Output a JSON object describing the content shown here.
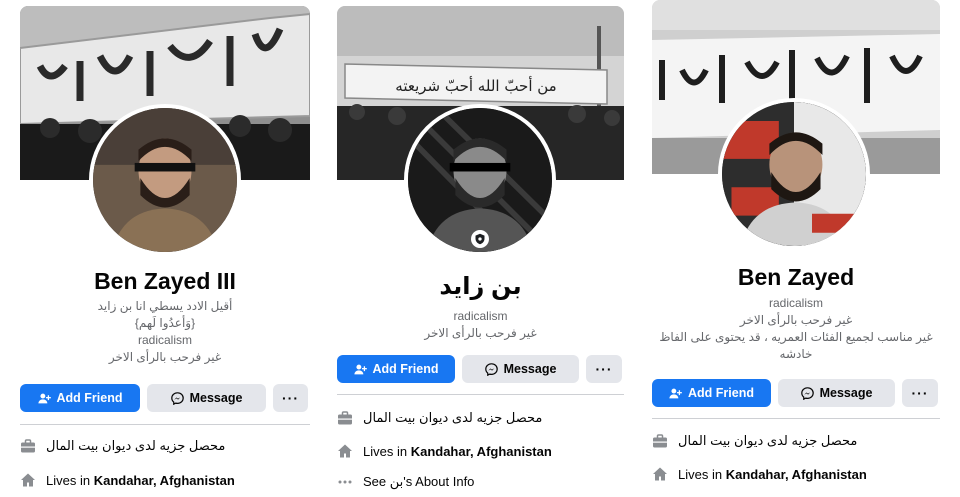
{
  "profiles": [
    {
      "name": "Ben Zayed III",
      "bio": [
        "أقيل الادد يسطي انا بن زايد",
        "{وَأعدُوا لَهم}",
        "radicalism",
        "غير فرحب بالرأى الاخر"
      ],
      "cover_banner_text": "ان الحكم الا لله",
      "buttons": {
        "add_friend": "Add Friend",
        "message": "Message",
        "more": "···"
      },
      "info": {
        "work_text": "محصل جزيه لدى ديوان بيت المال",
        "lives_prefix": "Lives in ",
        "lives_place": "Kandahar, Afghanistan"
      }
    },
    {
      "name": "بن زايد",
      "bio": [
        "radicalism",
        "غير فرحب بالرأى الاخر"
      ],
      "cover_banner_text": "من أحبّ الله أحبّ شريعته",
      "buttons": {
        "add_friend": "Add Friend",
        "message": "Message",
        "more": "···"
      },
      "info": {
        "work_text": "محصل جزيه لدى ديوان بيت المال",
        "lives_prefix": "Lives in ",
        "lives_place": "Kandahar, Afghanistan",
        "about_prefix": "See ",
        "about_name": "بن",
        "about_suffix": "'s About Info"
      }
    },
    {
      "name": "Ben Zayed",
      "bio": [
        "radicalism",
        "غير فرحب بالرأى الاخر",
        "غير مناسب لجميع الفئات العمريه ، قد يحتوى على الفاظ",
        "خادشه"
      ],
      "cover_banner_text": "ان الحكم الا لله امر الا تعبدوا الا اياه",
      "buttons": {
        "add_friend": "Add Friend",
        "message": "Message",
        "more": "···"
      },
      "info": {
        "work_text": "محصل جزيه لدى ديوان بيت المال",
        "lives_prefix": "Lives in ",
        "lives_place": "Kandahar, Afghanistan"
      }
    }
  ],
  "icons": {
    "add_friend": "add-person-icon",
    "message": "messenger-icon",
    "work": "briefcase-icon",
    "home": "home-icon",
    "more": "more-dots-icon",
    "shield": "profile-guard-shield-icon"
  },
  "colors": {
    "primary": "#1877f2",
    "secondary_button": "#e4e6eb",
    "text": "#050505",
    "muted_text": "#65676b",
    "divider": "#ced0d4"
  }
}
